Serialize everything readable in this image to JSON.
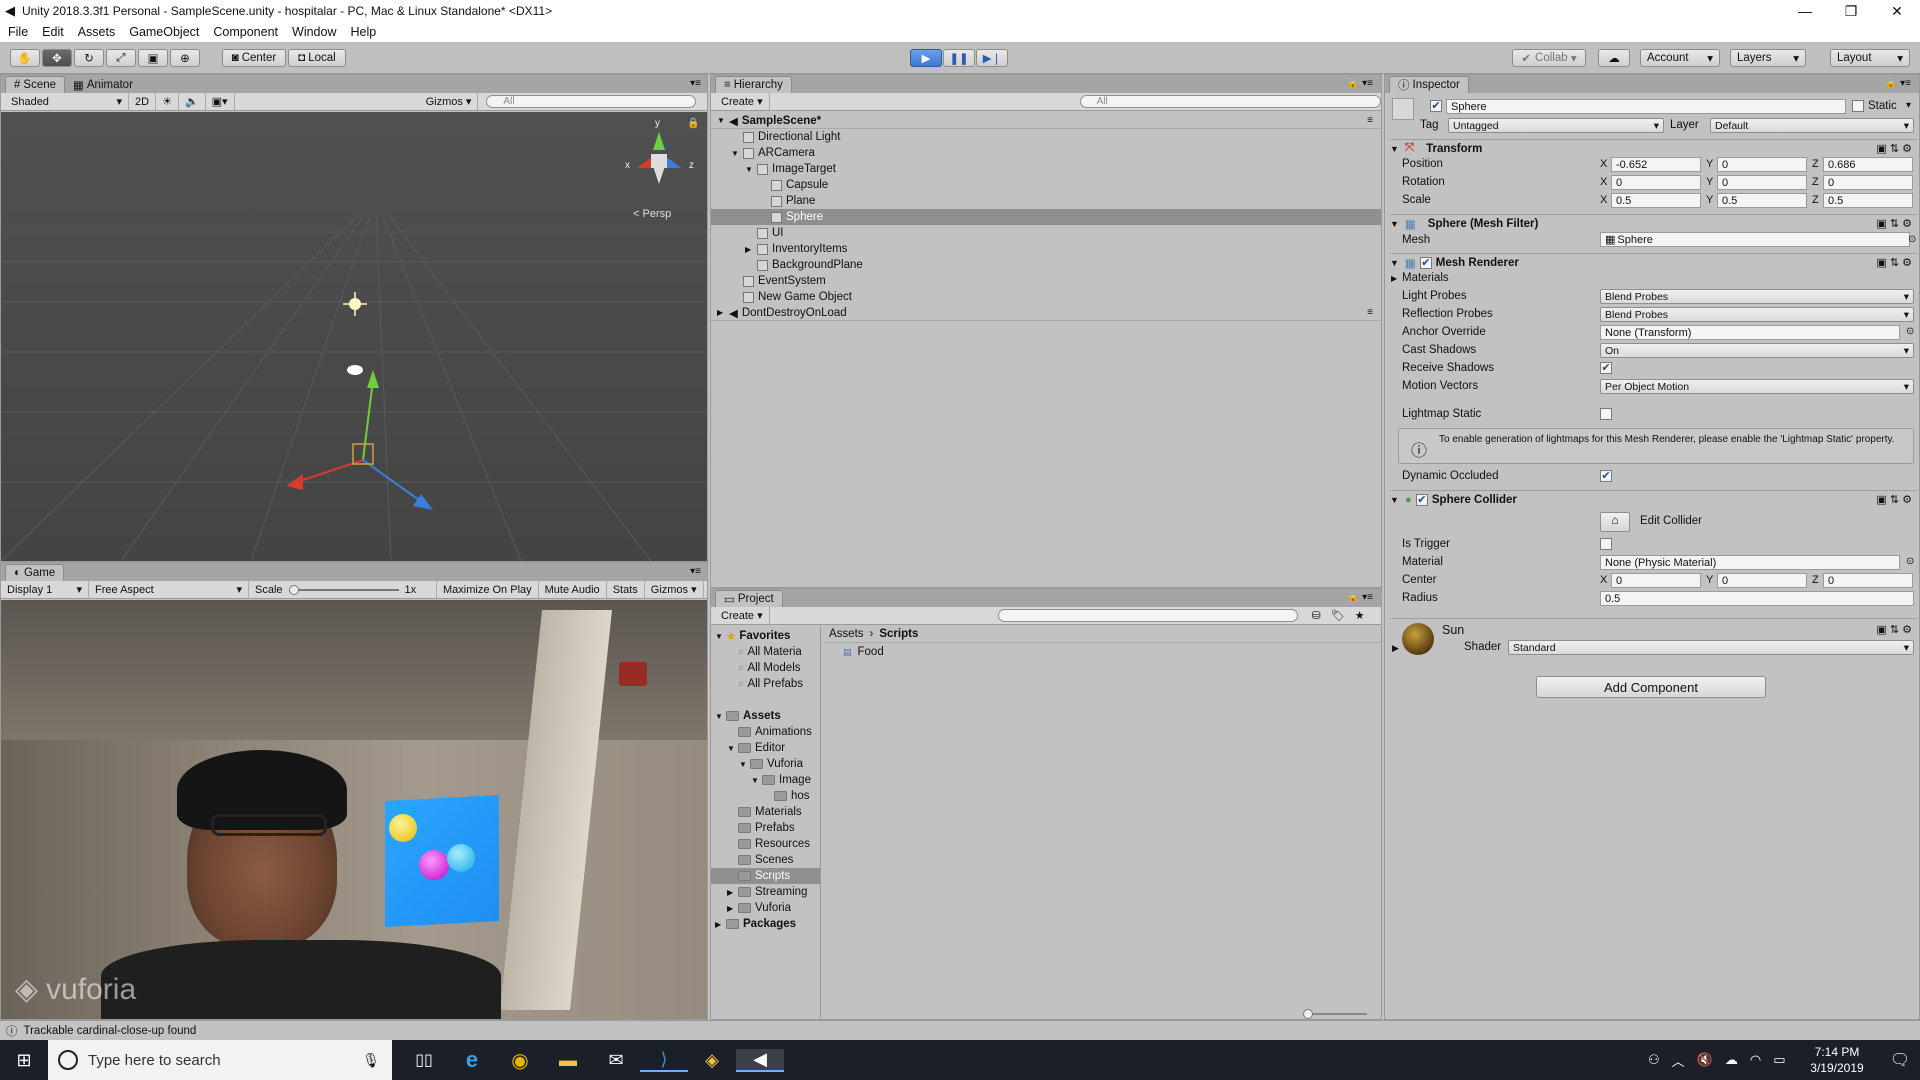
{
  "window": {
    "title": "Unity 2018.3.3f1 Personal - SampleScene.unity - hospitalar - PC, Mac & Linux Standalone* <DX11>",
    "controls": [
      "—",
      "❐",
      "✕"
    ]
  },
  "menu": [
    "File",
    "Edit",
    "Assets",
    "GameObject",
    "Component",
    "Window",
    "Help"
  ],
  "toolbar": {
    "pivot": "Center",
    "space": "Local",
    "collab": "Collab",
    "account": "Account",
    "layers": "Layers",
    "layout": "Layout"
  },
  "scene": {
    "tabs": [
      "Scene",
      "Animator"
    ],
    "shading": "Shaded",
    "mode2d": "2D",
    "gizmos": "Gizmos",
    "search_placeholder": "All",
    "persp": "Persp",
    "axis_y": "y",
    "axis_x": "x",
    "axis_z": "z"
  },
  "game": {
    "tab": "Game",
    "display": "Display 1",
    "aspect": "Free Aspect",
    "scale_label": "Scale",
    "scale_value": "1x",
    "maximize": "Maximize On Play",
    "mute": "Mute Audio",
    "stats": "Stats",
    "gizmos": "Gizmos",
    "watermark": "vuforia"
  },
  "hierarchy": {
    "tab": "Hierarchy",
    "create": "Create",
    "search_placeholder": "All",
    "items": [
      {
        "label": "SampleScene*",
        "depth": 0,
        "bold": true,
        "arrow": "▼",
        "type": "scene"
      },
      {
        "label": "Directional Light",
        "depth": 1,
        "arrow": "",
        "type": "obj"
      },
      {
        "label": "ARCamera",
        "depth": 1,
        "arrow": "▼",
        "type": "obj"
      },
      {
        "label": "ImageTarget",
        "depth": 2,
        "arrow": "▼",
        "type": "obj"
      },
      {
        "label": "Capsule",
        "depth": 3,
        "arrow": "",
        "type": "obj"
      },
      {
        "label": "Plane",
        "depth": 3,
        "arrow": "",
        "type": "obj"
      },
      {
        "label": "Sphere",
        "depth": 3,
        "arrow": "",
        "type": "obj",
        "selected": true
      },
      {
        "label": "UI",
        "depth": 2,
        "arrow": "",
        "type": "obj"
      },
      {
        "label": "InventoryItems",
        "depth": 2,
        "arrow": "▶",
        "type": "obj"
      },
      {
        "label": "BackgroundPlane",
        "depth": 2,
        "arrow": "",
        "type": "obj"
      },
      {
        "label": "EventSystem",
        "depth": 1,
        "arrow": "",
        "type": "obj"
      },
      {
        "label": "New Game Object",
        "depth": 1,
        "arrow": "",
        "type": "obj"
      },
      {
        "label": "DontDestroyOnLoad",
        "depth": 0,
        "arrow": "▶",
        "type": "scene"
      }
    ]
  },
  "project": {
    "tab": "Project",
    "create": "Create",
    "breadcrumb": [
      "Assets",
      "Scripts"
    ],
    "files": [
      "Food"
    ],
    "tree": [
      {
        "label": "Favorites",
        "depth": 0,
        "bold": true,
        "arrow": "▼",
        "icon": "star"
      },
      {
        "label": "All Materia",
        "depth": 1,
        "arrow": "",
        "icon": "search"
      },
      {
        "label": "All Models",
        "depth": 1,
        "arrow": "",
        "icon": "search"
      },
      {
        "label": "All Prefabs",
        "depth": 1,
        "arrow": "",
        "icon": "search"
      },
      {
        "label": "",
        "depth": 0,
        "arrow": "",
        "icon": "none"
      },
      {
        "label": "Assets",
        "depth": 0,
        "bold": true,
        "arrow": "▼",
        "icon": "folder"
      },
      {
        "label": "Animations",
        "depth": 1,
        "arrow": "",
        "icon": "folder"
      },
      {
        "label": "Editor",
        "depth": 1,
        "arrow": "▼",
        "icon": "folder"
      },
      {
        "label": "Vuforia",
        "depth": 2,
        "arrow": "▼",
        "icon": "folder"
      },
      {
        "label": "Image",
        "depth": 3,
        "arrow": "▼",
        "icon": "folder"
      },
      {
        "label": "hos",
        "depth": 4,
        "arrow": "",
        "icon": "folder"
      },
      {
        "label": "Materials",
        "depth": 1,
        "arrow": "",
        "icon": "folder"
      },
      {
        "label": "Prefabs",
        "depth": 1,
        "arrow": "",
        "icon": "folder"
      },
      {
        "label": "Resources",
        "depth": 1,
        "arrow": "",
        "icon": "folder"
      },
      {
        "label": "Scenes",
        "depth": 1,
        "arrow": "",
        "icon": "folder"
      },
      {
        "label": "Scripts",
        "depth": 1,
        "arrow": "",
        "icon": "folder",
        "selected": true
      },
      {
        "label": "Streaming",
        "depth": 1,
        "arrow": "▶",
        "icon": "folder"
      },
      {
        "label": "Vuforia",
        "depth": 1,
        "arrow": "▶",
        "icon": "folder"
      },
      {
        "label": "Packages",
        "depth": 0,
        "bold": true,
        "arrow": "▶",
        "icon": "folder"
      }
    ]
  },
  "inspector": {
    "tab": "Inspector",
    "object_name": "Sphere",
    "static_label": "Static",
    "tag_label": "Tag",
    "tag_value": "Untagged",
    "layer_label": "Layer",
    "layer_value": "Default",
    "transform": {
      "title": "Transform",
      "position_label": "Position",
      "rotation_label": "Rotation",
      "scale_label": "Scale",
      "position": [
        "-0.652",
        "0",
        "0.686"
      ],
      "rotation": [
        "0",
        "0",
        "0"
      ],
      "scale": [
        "0.5",
        "0.5",
        "0.5"
      ],
      "axes": [
        "X",
        "Y",
        "Z"
      ]
    },
    "mesh_filter": {
      "title": "Sphere (Mesh Filter)",
      "mesh_label": "Mesh",
      "mesh_value": "Sphere"
    },
    "mesh_renderer": {
      "title": "Mesh Renderer",
      "materials_label": "Materials",
      "light_probes_label": "Light Probes",
      "light_probes": "Blend Probes",
      "reflection_probes_label": "Reflection Probes",
      "reflection_probes": "Blend Probes",
      "anchor_override_label": "Anchor Override",
      "anchor_override": "None (Transform)",
      "cast_shadows_label": "Cast Shadows",
      "cast_shadows": "On",
      "receive_shadows_label": "Receive Shadows",
      "motion_vectors_label": "Motion Vectors",
      "motion_vectors": "Per Object Motion",
      "lightmap_static_label": "Lightmap Static",
      "info": "To enable generation of lightmaps for this Mesh Renderer, please enable the 'Lightmap Static' property.",
      "dynamic_occluded_label": "Dynamic Occluded"
    },
    "sphere_collider": {
      "title": "Sphere Collider",
      "edit_collider": "Edit Collider",
      "is_trigger_label": "Is Trigger",
      "material_label": "Material",
      "material_value": "None (Physic Material)",
      "center_label": "Center",
      "center": [
        "0",
        "0",
        "0"
      ],
      "radius_label": "Radius",
      "radius": "0.5"
    },
    "material": {
      "name": "Sun",
      "shader_label": "Shader",
      "shader_value": "Standard"
    },
    "add_component": "Add Component"
  },
  "status": "Trackable cardinal-close-up found",
  "taskbar": {
    "search_placeholder": "Type here to search",
    "time": "7:14 PM",
    "date": "3/19/2019"
  }
}
